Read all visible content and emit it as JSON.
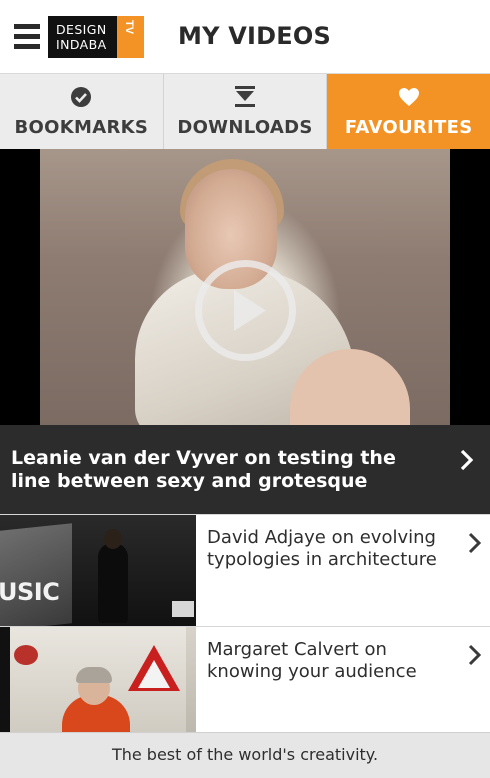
{
  "header": {
    "menu_icon": "hamburger-menu-icon",
    "logo_text": "DESIGN\nINDABA",
    "logo_tv": "TV",
    "title": "MY VIDEOS"
  },
  "tabs": [
    {
      "label": "BOOKMARKS",
      "icon": "checkmark-circle-icon",
      "active": false
    },
    {
      "label": "DOWNLOADS",
      "icon": "download-icon",
      "active": false
    },
    {
      "label": "FAVOURITES",
      "icon": "heart-icon",
      "active": true
    }
  ],
  "featured": {
    "title": "Leanie van der Vyver on testing the line between sexy and grotesque",
    "play_icon": "play-icon",
    "chevron_icon": "chevron-right-icon"
  },
  "videos": [
    {
      "title": "David Adjaye on evolving typologies in architecture",
      "thumb_text": "USIC"
    },
    {
      "title": "Margaret Calvert on knowing your audience"
    }
  ],
  "footer": {
    "tagline": "The best of the world's creativity."
  },
  "colors": {
    "accent": "#f39325",
    "caption_bg": "#2c2c2c",
    "tab_bg": "#ececec"
  }
}
